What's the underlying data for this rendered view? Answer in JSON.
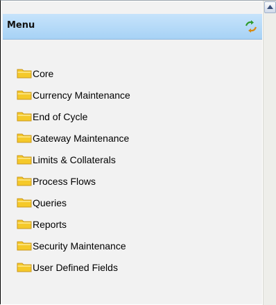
{
  "menu": {
    "title": "Menu",
    "refresh_icon": "refresh-arrows-icon",
    "items": [
      {
        "label": "Core",
        "icon": "folder-icon"
      },
      {
        "label": "Currency Maintenance",
        "icon": "folder-icon"
      },
      {
        "label": "End of Cycle",
        "icon": "folder-icon"
      },
      {
        "label": "Gateway Maintenance",
        "icon": "folder-icon"
      },
      {
        "label": "Limits & Collaterals",
        "icon": "folder-icon"
      },
      {
        "label": "Process Flows",
        "icon": "folder-icon"
      },
      {
        "label": "Queries",
        "icon": "folder-icon"
      },
      {
        "label": "Reports",
        "icon": "folder-icon"
      },
      {
        "label": "Security Maintenance",
        "icon": "folder-icon"
      },
      {
        "label": "User Defined Fields",
        "icon": "folder-icon"
      }
    ]
  },
  "colors": {
    "header_bg": "#b6daf8",
    "panel_bg": "#f2f2f2",
    "folder_yellow": "#f5c92a"
  }
}
